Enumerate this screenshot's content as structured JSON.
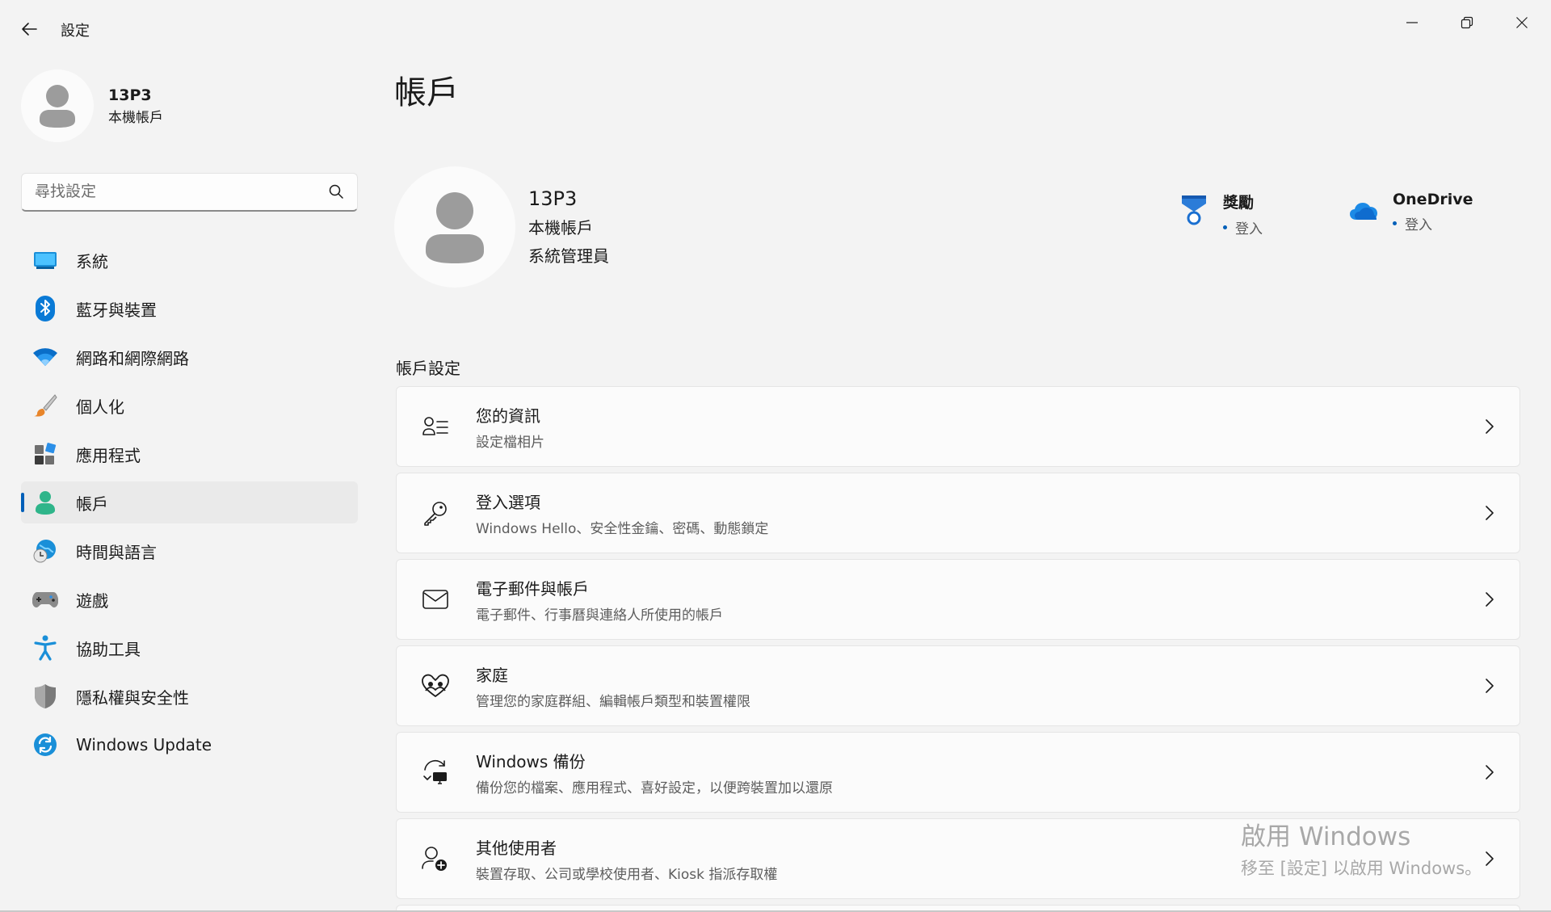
{
  "app": {
    "title": "設定",
    "back_icon": "back-arrow-icon",
    "window_controls": [
      "minimize-icon",
      "restore-icon",
      "close-icon"
    ]
  },
  "sidebar": {
    "profile": {
      "name": "13P3",
      "account_type": "本機帳戶"
    },
    "search": {
      "placeholder": "尋找設定",
      "value": "",
      "icon": "search-icon"
    },
    "items": [
      {
        "label": "系統",
        "icon": "system-display-icon",
        "active": false
      },
      {
        "label": "藍牙與裝置",
        "icon": "bluetooth-icon",
        "active": false
      },
      {
        "label": "網路和網際網路",
        "icon": "wifi-icon",
        "active": false
      },
      {
        "label": "個人化",
        "icon": "paintbrush-icon",
        "active": false
      },
      {
        "label": "應用程式",
        "icon": "apps-icon",
        "active": false
      },
      {
        "label": "帳戶",
        "icon": "account-icon",
        "active": true
      },
      {
        "label": "時間與語言",
        "icon": "globe-clock-icon",
        "active": false
      },
      {
        "label": "遊戲",
        "icon": "gamepad-icon",
        "active": false
      },
      {
        "label": "協助工具",
        "icon": "accessibility-icon",
        "active": false
      },
      {
        "label": "隱私權與安全性",
        "icon": "shield-icon",
        "active": false
      },
      {
        "label": "Windows Update",
        "icon": "windows-update-icon",
        "active": false
      }
    ]
  },
  "main": {
    "title": "帳戶",
    "profile": {
      "name": "13P3",
      "account_type": "本機帳戶",
      "role": "系統管理員"
    },
    "services": [
      {
        "name": "獎勵",
        "status": "登入",
        "icon": "rewards-medal-icon"
      },
      {
        "name": "OneDrive",
        "status": "登入",
        "icon": "onedrive-cloud-icon"
      }
    ],
    "section_label": "帳戶設定",
    "cards": [
      {
        "title": "您的資訊",
        "subtitle": "設定檔相片",
        "icon": "user-info-icon"
      },
      {
        "title": "登入選項",
        "subtitle": "Windows Hello、安全性金鑰、密碼、動態鎖定",
        "icon": "key-icon"
      },
      {
        "title": "電子郵件與帳戶",
        "subtitle": "電子郵件、行事曆與連絡人所使用的帳戶",
        "icon": "mail-icon"
      },
      {
        "title": "家庭",
        "subtitle": "管理您的家庭群組、編輯帳戶類型和裝置權限",
        "icon": "family-heart-icon"
      },
      {
        "title": "Windows 備份",
        "subtitle": "備份您的檔案、應用程式、喜好設定，以便跨裝置加以還原",
        "icon": "backup-sync-icon"
      },
      {
        "title": "其他使用者",
        "subtitle": "裝置存取、公司或學校使用者、Kiosk 指派存取權",
        "icon": "add-user-icon"
      }
    ]
  },
  "watermark": {
    "line1": "啟用 Windows",
    "line2": "移至 [設定] 以啟用 Windows。"
  }
}
